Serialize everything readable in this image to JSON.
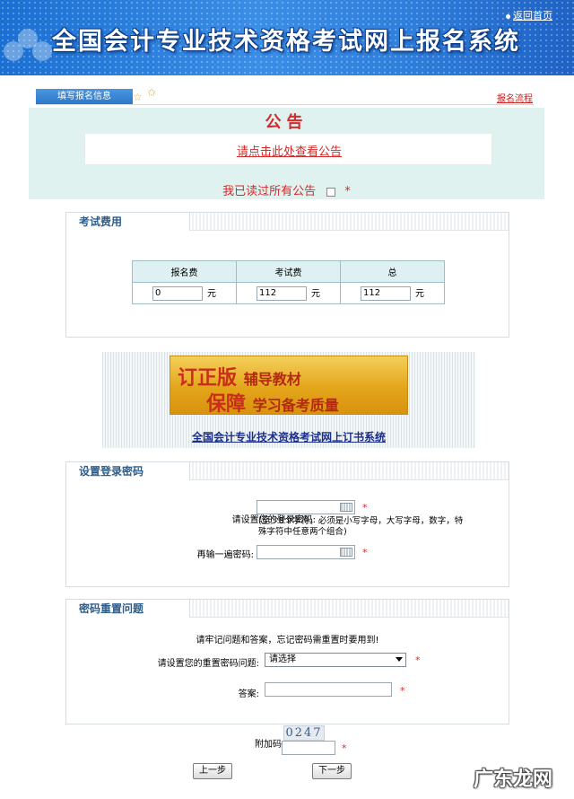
{
  "header": {
    "title": "全国会计专业技术资格考试网上报名系统",
    "home_link": "返回首页"
  },
  "tabs": {
    "fill_info": "填写报名信息",
    "process_link": "报名流程"
  },
  "notice": {
    "title": "公告",
    "link": "请点击此处查看公告",
    "read_label": "我已读过所有公告",
    "required_mark": "*"
  },
  "fees": {
    "section_title": "考试费用",
    "headers": [
      "报名费",
      "考试费",
      "总"
    ],
    "values": [
      "0",
      "112",
      "112"
    ],
    "unit": "元"
  },
  "ad": {
    "line1_big": "订正版",
    "line1_small": "辅导教材",
    "line2_big": "保障",
    "line2_small": "学习备考质量",
    "link": "全国会计专业技术资格考试网上订书系统"
  },
  "password": {
    "section_title": "设置登录密码",
    "label": "请设置您的登录密码:",
    "hint_line1": "(至少8个字符，必须是小写字母，大写字母，数字，特",
    "hint_line2": "殊字符中任意两个组合)",
    "confirm_label": "再输一遍密码:",
    "required_mark": "*"
  },
  "security": {
    "section_title": "密码重置问题",
    "note": "请牢记问题和答案，忘记密码需重置时要用到!",
    "question_label": "请设置您的重置密码问题:",
    "question_selected": "请选择",
    "answer_label": "答案:",
    "required_mark": "*"
  },
  "captcha": {
    "label": "附加码",
    "image_text": "0247",
    "required_mark": "*"
  },
  "buttons": {
    "prev": "上一步",
    "next": "下一步"
  },
  "watermark": "广东龙网"
}
